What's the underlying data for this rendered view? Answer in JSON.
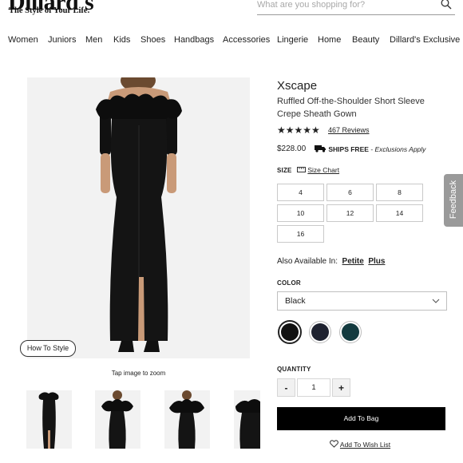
{
  "header": {
    "logo": "Dillard's",
    "tagline": "The Style of Your Life.",
    "search_placeholder": "What are you shopping for?"
  },
  "nav": [
    "Women",
    "Juniors",
    "Men",
    "Kids",
    "Shoes",
    "Handbags",
    "Accessories",
    "Lingerie",
    "Home",
    "Beauty",
    "Dillard's Exclusive"
  ],
  "gallery": {
    "how_to_style": "How To Style",
    "tap_to_zoom": "Tap image to zoom"
  },
  "product": {
    "brand": "Xscape",
    "name": "Ruffled Off-the-Shoulder Short Sleeve Crepe Sheath Gown",
    "stars": "★★★★★",
    "rating": 4.5,
    "reviews": "467 Reviews",
    "price": "$228.00",
    "ships_label": "SHIPS FREE",
    "ships_note": " - Exclusions Apply"
  },
  "size": {
    "label": "SIZE",
    "chart_link": "Size Chart",
    "options": [
      "4",
      "6",
      "8",
      "10",
      "12",
      "14",
      "16"
    ]
  },
  "availability": {
    "label": "Also Available In:",
    "options": [
      "Petite",
      "Plus"
    ]
  },
  "color": {
    "label": "COLOR",
    "selected": "Black",
    "swatches": [
      {
        "name": "black",
        "hex": "#111111"
      },
      {
        "name": "navy",
        "hex": "#1e2230"
      },
      {
        "name": "teal",
        "hex": "#133a3f"
      }
    ]
  },
  "quantity": {
    "label": "QUANTITY",
    "minus": "-",
    "value": "1",
    "plus": "+"
  },
  "actions": {
    "add_to_bag": "Add To Bag",
    "add_to_wish_list": "Add To Wish List"
  },
  "feedback_tab": "Feedback"
}
